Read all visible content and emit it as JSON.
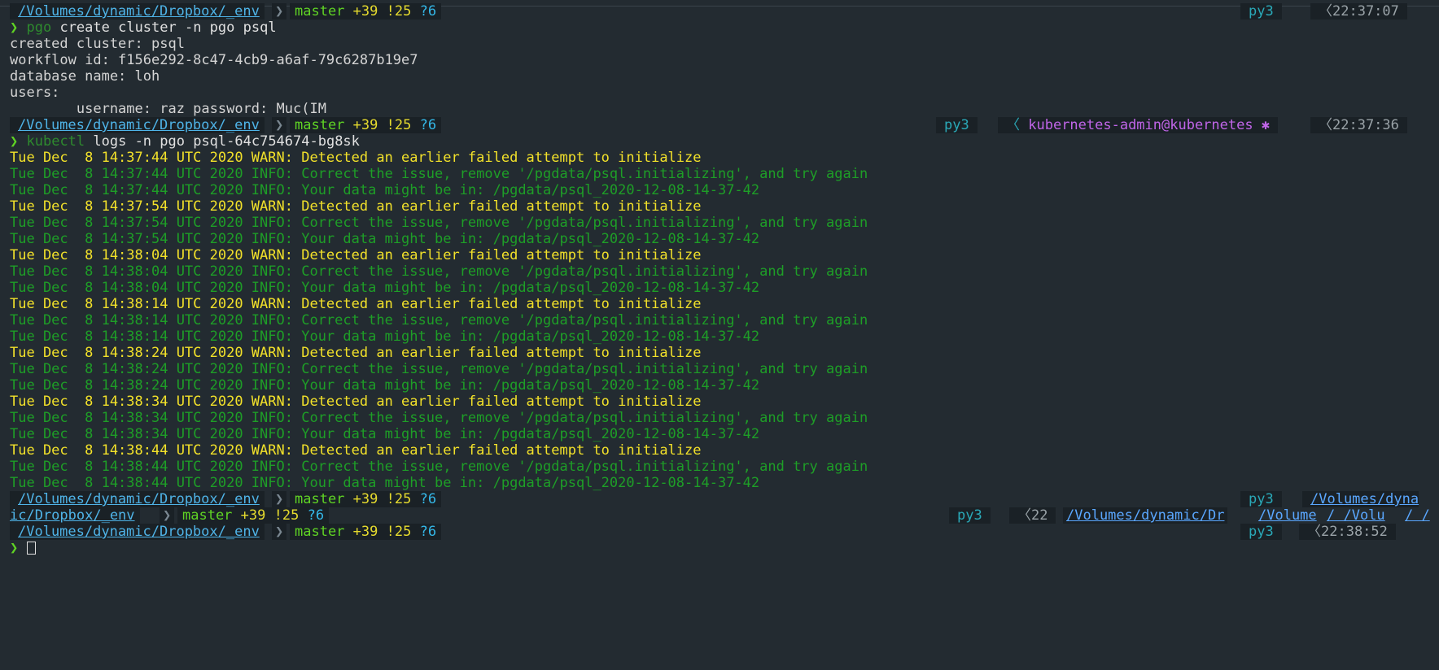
{
  "colors": {
    "background": "#232b31",
    "bar_background": "#1a2126",
    "path": "#4fb4e8",
    "branch": "#5fd324",
    "git_counts": "#e6db2e",
    "untracked": "#34b8e8",
    "warn": "#f2e12a",
    "info": "#1e9e27",
    "kube_context": "#c065e8"
  },
  "prompt1": {
    "path": "/Volumes/dynamic/Dropbox/_env",
    "branch": "master",
    "ahead": "+39",
    "modified": "!25",
    "untracked": "?6",
    "py": "py3",
    "time": "22:37:07"
  },
  "cmd1": {
    "arrow": "❯",
    "prog": "pgo",
    "args": " create cluster -n pgo psql"
  },
  "output1": [
    "created cluster: psql",
    "workflow id: f156e292-8c47-4cb9-a6af-79c6287b19e7",
    "database name: loh",
    "users:",
    "        username: raz password: Muc(IM"
  ],
  "prompt2": {
    "path": "/Volumes/dynamic/Dropbox/_env",
    "branch": "master",
    "ahead": "+39",
    "modified": "!25",
    "untracked": "?6",
    "py": "py3",
    "k8s_context": "kubernetes-admin@kubernetes",
    "k8s_icon": "✱",
    "time": "22:37:36"
  },
  "cmd2": {
    "arrow": "❯",
    "prog": "kubectl",
    "args": " logs -n pgo psql-64c754674-bg8sk"
  },
  "log_lines": [
    {
      "level": "warn",
      "text": "Tue Dec  8 14:37:44 UTC 2020 WARN: Detected an earlier failed attempt to initialize"
    },
    {
      "level": "info",
      "text": "Tue Dec  8 14:37:44 UTC 2020 INFO: Correct the issue, remove '/pgdata/psql.initializing', and try again"
    },
    {
      "level": "info",
      "text": "Tue Dec  8 14:37:44 UTC 2020 INFO: Your data might be in: /pgdata/psql_2020-12-08-14-37-42"
    },
    {
      "level": "warn",
      "text": "Tue Dec  8 14:37:54 UTC 2020 WARN: Detected an earlier failed attempt to initialize"
    },
    {
      "level": "info",
      "text": "Tue Dec  8 14:37:54 UTC 2020 INFO: Correct the issue, remove '/pgdata/psql.initializing', and try again"
    },
    {
      "level": "info",
      "text": "Tue Dec  8 14:37:54 UTC 2020 INFO: Your data might be in: /pgdata/psql_2020-12-08-14-37-42"
    },
    {
      "level": "warn",
      "text": "Tue Dec  8 14:38:04 UTC 2020 WARN: Detected an earlier failed attempt to initialize"
    },
    {
      "level": "info",
      "text": "Tue Dec  8 14:38:04 UTC 2020 INFO: Correct the issue, remove '/pgdata/psql.initializing', and try again"
    },
    {
      "level": "info",
      "text": "Tue Dec  8 14:38:04 UTC 2020 INFO: Your data might be in: /pgdata/psql_2020-12-08-14-37-42"
    },
    {
      "level": "warn",
      "text": "Tue Dec  8 14:38:14 UTC 2020 WARN: Detected an earlier failed attempt to initialize"
    },
    {
      "level": "info",
      "text": "Tue Dec  8 14:38:14 UTC 2020 INFO: Correct the issue, remove '/pgdata/psql.initializing', and try again"
    },
    {
      "level": "info",
      "text": "Tue Dec  8 14:38:14 UTC 2020 INFO: Your data might be in: /pgdata/psql_2020-12-08-14-37-42"
    },
    {
      "level": "warn",
      "text": "Tue Dec  8 14:38:24 UTC 2020 WARN: Detected an earlier failed attempt to initialize"
    },
    {
      "level": "info",
      "text": "Tue Dec  8 14:38:24 UTC 2020 INFO: Correct the issue, remove '/pgdata/psql.initializing', and try again"
    },
    {
      "level": "info",
      "text": "Tue Dec  8 14:38:24 UTC 2020 INFO: Your data might be in: /pgdata/psql_2020-12-08-14-37-42"
    },
    {
      "level": "warn",
      "text": "Tue Dec  8 14:38:34 UTC 2020 WARN: Detected an earlier failed attempt to initialize"
    },
    {
      "level": "info",
      "text": "Tue Dec  8 14:38:34 UTC 2020 INFO: Correct the issue, remove '/pgdata/psql.initializing', and try again"
    },
    {
      "level": "info",
      "text": "Tue Dec  8 14:38:34 UTC 2020 INFO: Your data might be in: /pgdata/psql_2020-12-08-14-37-42"
    },
    {
      "level": "warn",
      "text": "Tue Dec  8 14:38:44 UTC 2020 WARN: Detected an earlier failed attempt to initialize"
    },
    {
      "level": "info",
      "text": "Tue Dec  8 14:38:44 UTC 2020 INFO: Correct the issue, remove '/pgdata/psql.initializing', and try again"
    },
    {
      "level": "info",
      "text": "Tue Dec  8 14:38:44 UTC 2020 INFO: Your data might be in: /pgdata/psql_2020-12-08-14-37-42"
    }
  ],
  "prompt3": {
    "path": "/Volumes/dynamic/Dropbox/_env",
    "branch": "master",
    "ahead": "+39",
    "modified": "!25",
    "untracked": "?6",
    "py": "py3",
    "right_path": "/Volumes/dyna"
  },
  "prompt3_wrap": {
    "path_tail": "ic/Dropbox/_env",
    "branch": "master",
    "ahead": "+39",
    "modified": "!25",
    "untracked": "?6",
    "py": "py3",
    "time_partial": "22",
    "right_path": "/Volumes/dynamic/Dr",
    "right_path2": "/Volume",
    "right_path3": "/ /Volu",
    "right_path4": "/ /"
  },
  "prompt4": {
    "path": "/Volumes/dynamic/Dropbox/_env",
    "branch": "master",
    "ahead": "+39",
    "modified": "!25",
    "untracked": "?6",
    "py": "py3",
    "time": "22:38:52"
  },
  "cmd4": {
    "arrow": "❯"
  },
  "glyphs": {
    "chevron_right": "❯",
    "chevron_left": "〈",
    "separator": "❯"
  }
}
